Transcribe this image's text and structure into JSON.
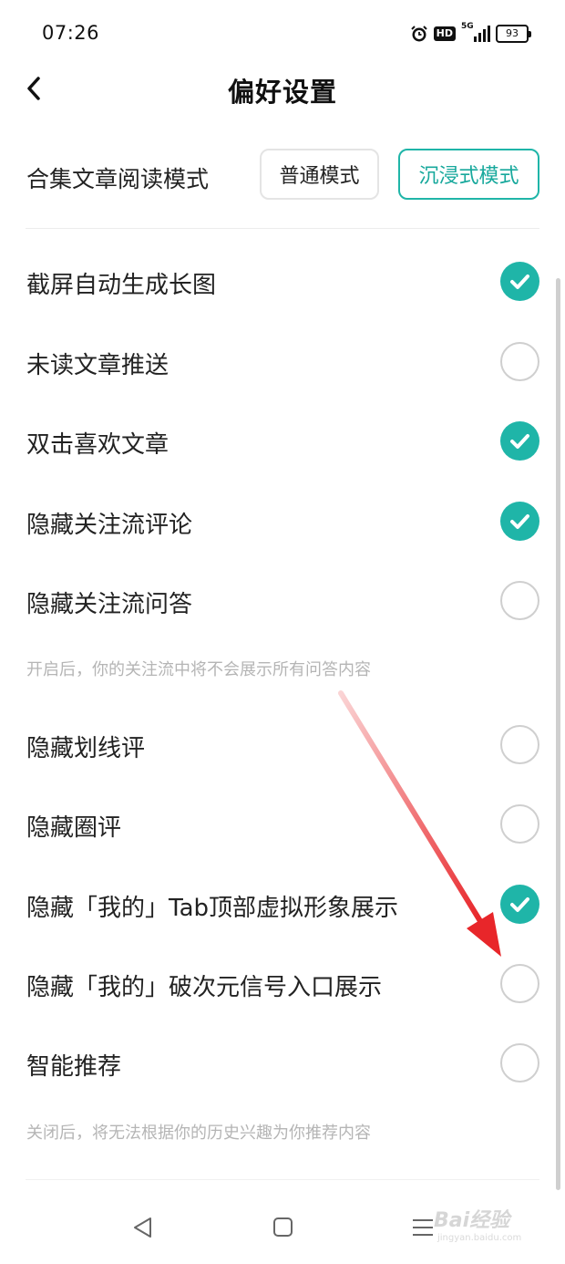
{
  "status_bar": {
    "time": "07:26",
    "network": "5G",
    "hd_label": "HD",
    "battery": "93"
  },
  "header": {
    "title": "偏好设置",
    "back_icon": "chevron-left-icon"
  },
  "reading_mode": {
    "label": "合集文章阅读模式",
    "options": [
      "普通模式",
      "沉浸式模式"
    ],
    "selected": "沉浸式模式"
  },
  "settings": [
    {
      "label": "截屏自动生成长图",
      "checked": true
    },
    {
      "label": "未读文章推送",
      "checked": false
    },
    {
      "label": "双击喜欢文章",
      "checked": true
    },
    {
      "label": "隐藏关注流评论",
      "checked": true
    },
    {
      "label": "隐藏关注流问答",
      "checked": false,
      "hint": "开启后，你的关注流中将不会展示所有问答内容"
    },
    {
      "label": "隐藏划线评",
      "checked": false
    },
    {
      "label": "隐藏圈评",
      "checked": false
    },
    {
      "label": "隐藏「我的」Tab顶部虚拟形象展示",
      "checked": true
    },
    {
      "label": "隐藏「我的」破次元信号入口展示",
      "checked": false
    },
    {
      "label": "智能推荐",
      "checked": false,
      "hint": "关闭后，将无法根据你的历史兴趣为你推荐内容"
    }
  ],
  "colors": {
    "accent": "#1fb5a8",
    "annotation_arrow": "#e8262a"
  },
  "navbar": {
    "icons": [
      "triangle-back-icon",
      "square-home-icon",
      "menu-lines-icon"
    ],
    "watermark": "Bai经验",
    "watermark_sub": "jingyan.baidu.com"
  }
}
